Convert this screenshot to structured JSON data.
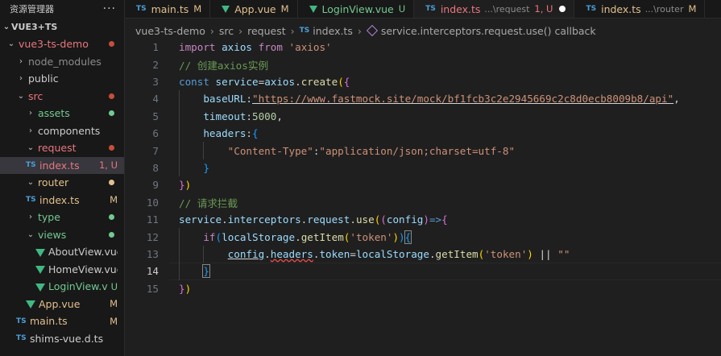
{
  "explorer": {
    "title": "资源管理器",
    "more": "···",
    "section": "VUE3+TS",
    "items": [
      {
        "chev": "⌄",
        "label": "vue3-ts-demo",
        "badge": "",
        "dot": true,
        "color": "red"
      },
      {
        "chev": "›",
        "label": "node_modules",
        "badge": "",
        "dot": false,
        "color": "gray"
      },
      {
        "chev": "›",
        "label": "public",
        "badge": "",
        "dot": false,
        "color": "normal"
      },
      {
        "chev": "⌄",
        "label": "src",
        "badge": "",
        "dot": true,
        "color": "red"
      },
      {
        "chev": "›",
        "label": "assets",
        "badge": "",
        "dot": true,
        "color": "green"
      },
      {
        "chev": "›",
        "label": "components",
        "badge": "",
        "dot": false,
        "color": "normal"
      },
      {
        "chev": "⌄",
        "label": "request",
        "badge": "",
        "dot": true,
        "color": "red"
      },
      {
        "icon": "TS",
        "label": "index.ts",
        "badge": "1, U",
        "color": "red"
      },
      {
        "chev": "⌄",
        "label": "router",
        "badge": "",
        "dot": true,
        "color": "yellow"
      },
      {
        "icon": "TS",
        "label": "index.ts",
        "badge": "M",
        "color": "yellow"
      },
      {
        "chev": "›",
        "label": "type",
        "badge": "",
        "dot": true,
        "color": "green"
      },
      {
        "chev": "⌄",
        "label": "views",
        "badge": "",
        "dot": true,
        "color": "green"
      },
      {
        "icon": "vue",
        "label": "AboutView.vue",
        "badge": "",
        "color": "normal"
      },
      {
        "icon": "vue",
        "label": "HomeView.vue",
        "badge": "",
        "color": "normal"
      },
      {
        "icon": "vue",
        "label": "LoginView.vue",
        "badge": "U",
        "color": "green"
      },
      {
        "icon": "vue",
        "label": "App.vue",
        "badge": "M",
        "color": "yellow"
      },
      {
        "icon": "TS",
        "label": "main.ts",
        "badge": "M",
        "color": "yellow"
      },
      {
        "icon": "TS",
        "label": "shims-vue.d.ts",
        "badge": "",
        "color": "normal"
      }
    ]
  },
  "tabs": [
    {
      "icon": "TS",
      "label": "main.ts",
      "desc": "",
      "mod": "M",
      "color": "yellow",
      "active": false
    },
    {
      "icon": "vue",
      "label": "App.vue",
      "desc": "",
      "mod": "M",
      "color": "yellow",
      "active": false
    },
    {
      "icon": "vue",
      "label": "LoginView.vue",
      "desc": "",
      "mod": "U",
      "color": "green",
      "active": false
    },
    {
      "icon": "TS",
      "label": "index.ts",
      "desc": "...\\request",
      "mod": "1, U",
      "color": "red",
      "active": true
    },
    {
      "icon": "TS",
      "label": "index.ts",
      "desc": "...\\router",
      "mod": "M",
      "color": "yellow",
      "active": false
    }
  ],
  "breadcrumb": {
    "parts": [
      "vue3-ts-demo",
      "src",
      "request",
      "index.ts"
    ],
    "symbol": "service.interceptors.request.use() callback"
  },
  "editor": {
    "active_line": 14,
    "lines": [
      {
        "n": "1",
        "tokens": [
          [
            "kw2",
            "import"
          ],
          [
            "pn",
            " "
          ],
          [
            "var",
            "axios"
          ],
          [
            "pn",
            " "
          ],
          [
            "kw2",
            "from"
          ],
          [
            "pn",
            " "
          ],
          [
            "str",
            "'axios'"
          ]
        ]
      },
      {
        "n": "2",
        "tokens": [
          [
            "cm",
            "// 创建axios实例"
          ]
        ]
      },
      {
        "n": "3",
        "tokens": [
          [
            "kw",
            "const"
          ],
          [
            "pn",
            " "
          ],
          [
            "var",
            "service"
          ],
          [
            "pn",
            "="
          ],
          [
            "var",
            "axios"
          ],
          [
            "pn",
            "."
          ],
          [
            "fn",
            "create"
          ],
          [
            "br1",
            "("
          ],
          [
            "br2",
            "{"
          ]
        ]
      },
      {
        "n": "4",
        "tokens": [
          [
            "pn",
            "    "
          ],
          [
            "var",
            "baseURL"
          ],
          [
            "pn",
            ":"
          ],
          [
            "str ul",
            "\"https://www.fastmock.site/mock/bf1fcb3c2e2945669c2c8d0ecb8009b8/api\""
          ],
          [
            "pn",
            ","
          ]
        ]
      },
      {
        "n": "5",
        "tokens": [
          [
            "pn",
            "    "
          ],
          [
            "var",
            "timeout"
          ],
          [
            "pn",
            ":"
          ],
          [
            "num",
            "5000"
          ],
          [
            "pn",
            ","
          ]
        ]
      },
      {
        "n": "6",
        "tokens": [
          [
            "pn",
            "    "
          ],
          [
            "var",
            "headers"
          ],
          [
            "pn",
            ":"
          ],
          [
            "br3",
            "{"
          ]
        ]
      },
      {
        "n": "7",
        "tokens": [
          [
            "pn",
            "        "
          ],
          [
            "str",
            "\"Content-Type\""
          ],
          [
            "pn",
            ":"
          ],
          [
            "str",
            "\"application/json;charset=utf-8\""
          ]
        ]
      },
      {
        "n": "8",
        "tokens": [
          [
            "pn",
            "    "
          ],
          [
            "br3",
            "}"
          ]
        ]
      },
      {
        "n": "9",
        "tokens": [
          [
            "br2",
            "}"
          ],
          [
            "br1",
            ")"
          ]
        ]
      },
      {
        "n": "10",
        "tokens": [
          [
            "cm",
            "// 请求拦截"
          ]
        ]
      },
      {
        "n": "11",
        "tokens": [
          [
            "var",
            "service"
          ],
          [
            "pn",
            "."
          ],
          [
            "var",
            "interceptors"
          ],
          [
            "pn",
            "."
          ],
          [
            "var",
            "request"
          ],
          [
            "pn",
            "."
          ],
          [
            "fn",
            "use"
          ],
          [
            "br1",
            "("
          ],
          [
            "br2",
            "("
          ],
          [
            "var",
            "config"
          ],
          [
            "br2",
            ")"
          ],
          [
            "kw",
            "=>"
          ],
          [
            "br2",
            "{"
          ]
        ]
      },
      {
        "n": "12",
        "tokens": [
          [
            "pn",
            "    "
          ],
          [
            "kw2",
            "if"
          ],
          [
            "br3",
            "("
          ],
          [
            "var",
            "localStorage"
          ],
          [
            "pn",
            "."
          ],
          [
            "fn",
            "getItem"
          ],
          [
            "br1",
            "("
          ],
          [
            "str",
            "'token'"
          ],
          [
            "br1",
            ")"
          ],
          [
            "br3",
            ")"
          ],
          [
            "br3 bbox",
            "{"
          ]
        ]
      },
      {
        "n": "13",
        "tokens": [
          [
            "pn",
            "        "
          ],
          [
            "var ul",
            "config"
          ],
          [
            "pn",
            "."
          ],
          [
            "var squig",
            "headers"
          ],
          [
            "pn",
            "."
          ],
          [
            "var",
            "token"
          ],
          [
            "pn",
            "="
          ],
          [
            "var",
            "localStorage"
          ],
          [
            "pn",
            "."
          ],
          [
            "fn",
            "getItem"
          ],
          [
            "br1",
            "("
          ],
          [
            "str",
            "'token'"
          ],
          [
            "br1",
            ")"
          ],
          [
            "pn",
            " || "
          ],
          [
            "str",
            "\"\""
          ]
        ]
      },
      {
        "n": "14",
        "tokens": [
          [
            "pn",
            "    "
          ],
          [
            "br3 bbox",
            "}"
          ],
          [
            "cursor",
            ""
          ]
        ]
      },
      {
        "n": "15",
        "tokens": [
          [
            "br2",
            "}"
          ],
          [
            "br1",
            ")"
          ]
        ]
      }
    ]
  }
}
